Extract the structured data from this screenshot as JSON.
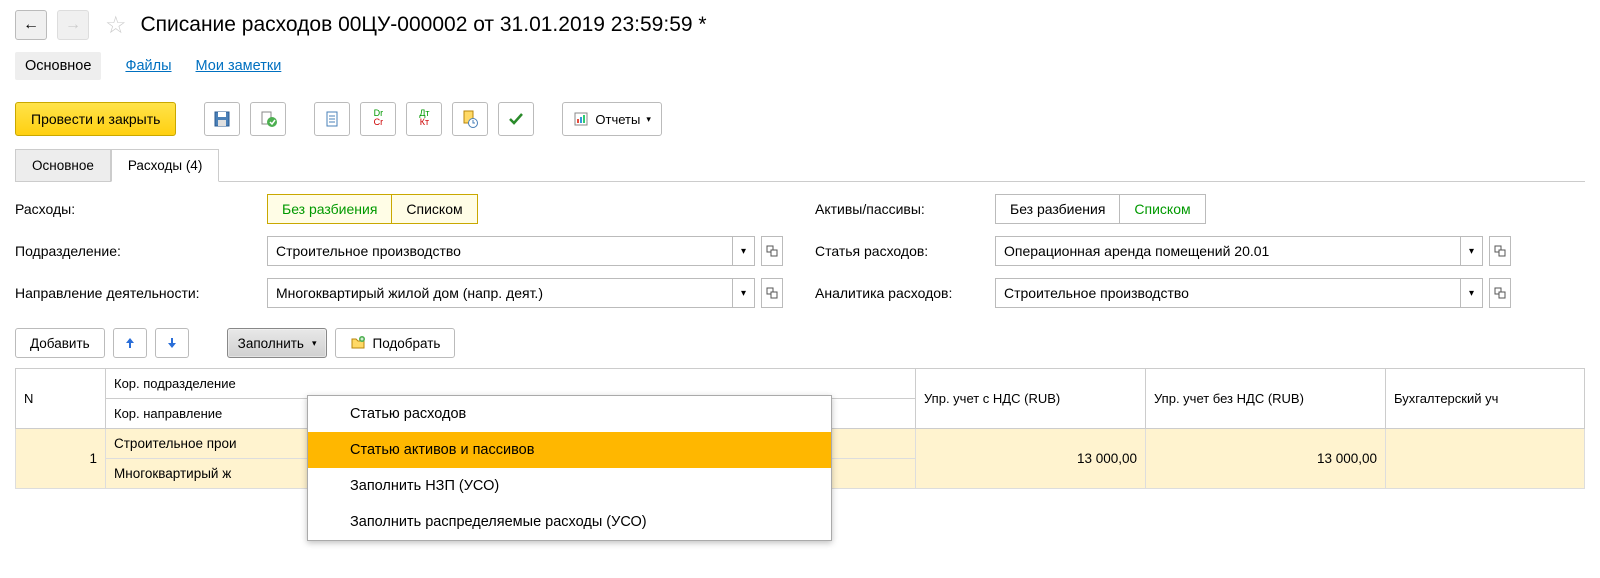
{
  "title": "Списание расходов 00ЦУ-000002 от 31.01.2019 23:59:59 *",
  "links": {
    "main": "Основное",
    "files": "Файлы",
    "notes": "Мои заметки"
  },
  "toolbar": {
    "post_close": "Провести и закрыть",
    "reports": "Отчеты"
  },
  "tabs": {
    "main": "Основное",
    "exp": "Расходы (4)"
  },
  "form": {
    "expenses_lbl": "Расходы:",
    "seg_no_split": "Без разбиения",
    "seg_list": "Списком",
    "assets_lbl": "Активы/пассивы:",
    "division_lbl": "Подразделение:",
    "division_val": "Строительное производство",
    "item_lbl": "Статья расходов:",
    "item_val": "Операционная аренда помещений 20.01",
    "direction_lbl": "Направление деятельности:",
    "direction_val": "Многоквартирый жилой дом (напр. деят.)",
    "analytics_lbl": "Аналитика расходов:",
    "analytics_val": "Строительное производство"
  },
  "table_toolbar": {
    "add": "Добавить",
    "fill": "Заполнить",
    "pick": "Подобрать"
  },
  "dropdown": {
    "i1": "Статью расходов",
    "i2": "Статью активов и пассивов",
    "i3": "Заполнить НЗП (УСО)",
    "i4": "Заполнить распределяемые расходы (УСО)"
  },
  "grid": {
    "h_n": "N",
    "h_div": "Кор. подразделение",
    "h_dir": "Кор. направление",
    "h_vat": "Упр. учет с НДС (RUB)",
    "h_novat": "Упр. учет без НДС (RUB)",
    "h_acc": "Бухгалтерский уч",
    "rows": [
      {
        "n": "1",
        "div": "Строительное прои",
        "dir": "Многоквартирый ж",
        "vat": "13 000,00",
        "novat": "13 000,00",
        "acc": ""
      }
    ]
  }
}
